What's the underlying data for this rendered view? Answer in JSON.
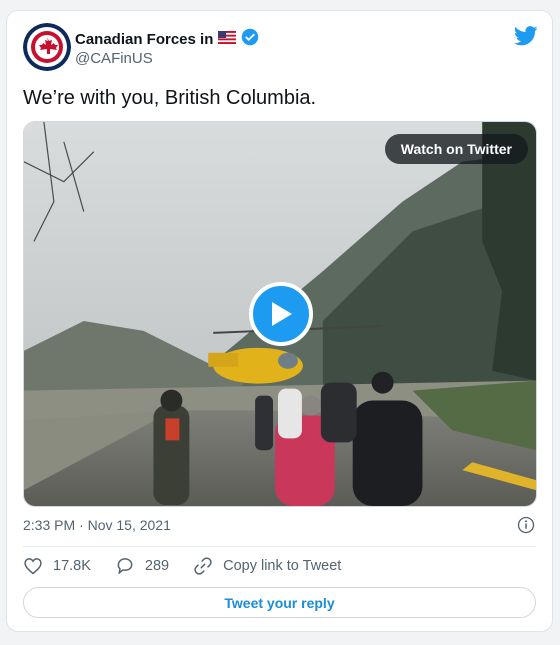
{
  "author": {
    "name": "Canadian Forces in",
    "flag_icon": "us-flag-icon",
    "verified_icon": "verified-badge-icon",
    "handle": "@CAFinUS"
  },
  "brand_icon": "twitter-bird-icon",
  "tweet": {
    "text": "We’re with you, British Columbia."
  },
  "media": {
    "watch_label": "Watch on Twitter",
    "play_icon": "play-icon"
  },
  "meta": {
    "timestamp": "2:33 PM · Nov 15, 2021",
    "info_icon": "info-icon"
  },
  "actions": {
    "likes": "17.8K",
    "replies": "289",
    "copy_link_label": "Copy link to Tweet"
  },
  "reply_button": "Tweet your reply",
  "colors": {
    "accent": "#1d9bf0",
    "text_secondary": "#536471",
    "link": "#1a8cd8"
  }
}
